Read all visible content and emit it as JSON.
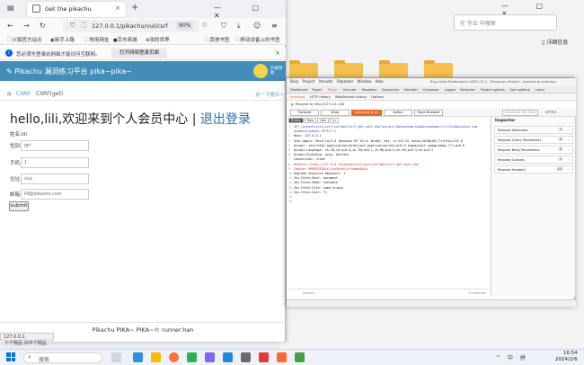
{
  "explorer": {
    "search_placeholder": "在 作业 中搜索",
    "details_label": "详细信息"
  },
  "firefox": {
    "tab_title": "Get the pikachu",
    "tab_close": "×",
    "new_tab": "+",
    "url": "127.0.0.1/pikachu/vul/csrf",
    "zoom": "90%",
    "bookmarks": [
      "火狐官方站点",
      "新手上路",
      "常用网址",
      "京东商城",
      "攻防世界",
      "其他书签",
      "移动设备上的书签"
    ],
    "notice_text": "您必须先登录此网络才能访问互联网。",
    "notice_button": "打开网络登录页面",
    "status_url": "127.0.0.1"
  },
  "pikachu": {
    "title": "Pikachu 漏洞练习平台 pika~pika~",
    "avatar_label": "升级赞助",
    "crumb1": "CSRF",
    "crumb_sep": "›",
    "crumb2": "CSRF(get)",
    "next_tip": "点一下提示~",
    "hello": "hello,lili,欢迎来到个人会员中心 | ",
    "logout": "退出登录",
    "name_line": "姓名:lili",
    "fields": [
      {
        "label": "性别:",
        "placeholder": "girl"
      },
      {
        "label": "手机:",
        "placeholder": "1"
      },
      {
        "label": "住址:",
        "placeholder": "usa"
      },
      {
        "label": "邮箱:",
        "placeholder": "lili@pikachu.com"
      }
    ],
    "submit": "submit",
    "footer": "Pikachu PIKA~ PIKA~© runner.han",
    "bottom_crumb": "十个物品   诉中个物品"
  },
  "burp": {
    "menu": [
      "Burp",
      "Project",
      "Intruder",
      "Repeater",
      "Window",
      "Help"
    ],
    "title": "Burp Suite Professional v2021.12.1 - Temporary Project - licensed to surferxyz",
    "tabs": [
      "Dashboard",
      "Target",
      "Proxy",
      "Intruder",
      "Repeater",
      "Sequencer",
      "Decoder",
      "Comparer",
      "Logger",
      "Extender",
      "Project options",
      "User options",
      "Learn"
    ],
    "subtabs": [
      "Intercept",
      "HTTP history",
      "WebSockets history",
      "Options"
    ],
    "request_to": "Request to http://127.0.0.1:80",
    "buttons": [
      "Forward",
      "Drop",
      "Intercept is on",
      "Action",
      "Open Browser"
    ],
    "comment_placeholder": "Comment this item",
    "http_version": "HTTP/1",
    "view_tabs": [
      "Pretty",
      "Raw",
      "Hex",
      "\\n"
    ],
    "lines": [
      "GET /pikachu/vul/csrf/csrfget/csrf_get_edit.php?sex=girl&phonenum=1&add=usa&email=lili%40pikachu.com",
      "&submit=submit HTTP/1.1",
      "Host: 127.0.0.1",
      "User-Agent: Mozilla/5.0 (Windows NT 10.0; Win64; x64; rv:122.0) Gecko/20100101 Firefox/122.0",
      "Accept: text/html,application/xhtml+xml,application/xml;q=0.9,image/avif,image/webp,*/*;q=0.8",
      "Accept-Language: zh-CN,zh;q=0.8,zh-TW;q=0.7,zh-HK;q=0.5,en-US;q=0.3,en;q=0.2",
      "Accept-Encoding: gzip, deflate",
      "Connection: close",
      "Referer: http://127.0.0.1/pikachu/vul/csrf/csrfget/csrf_get_edit.php",
      "Cookie: PHPSESSID=t1jvu5urdt1rrlhamb1g2o",
      "Upgrade-Insecure-Requests: 1",
      "Sec-Fetch-Dest: document",
      "Sec-Fetch-Mode: navigate",
      "Sec-Fetch-Site: same-origin",
      "Sec-Fetch-User: ?1",
      "",
      ""
    ],
    "search_placeholder": "Search...",
    "matches": "0 matches",
    "inspector_title": "Inspector",
    "inspector_rows": [
      {
        "label": "Request Attributes",
        "count": "2"
      },
      {
        "label": "Request Query Parameters",
        "count": "5"
      },
      {
        "label": "Request Body Parameters",
        "count": "0"
      },
      {
        "label": "Request Cookies",
        "count": "1"
      },
      {
        "label": "Request Headers",
        "count": "12"
      }
    ]
  },
  "taskbar": {
    "search_placeholder": "搜索",
    "time": "16:54",
    "date": "2024/2/6",
    "tray": "^ 中 拼"
  },
  "colors": {
    "pikachu_header": "#438eb9",
    "firefox_tab": "#ffffff",
    "burp_accent": "#e66b2a",
    "link": "#2a6fb2"
  }
}
